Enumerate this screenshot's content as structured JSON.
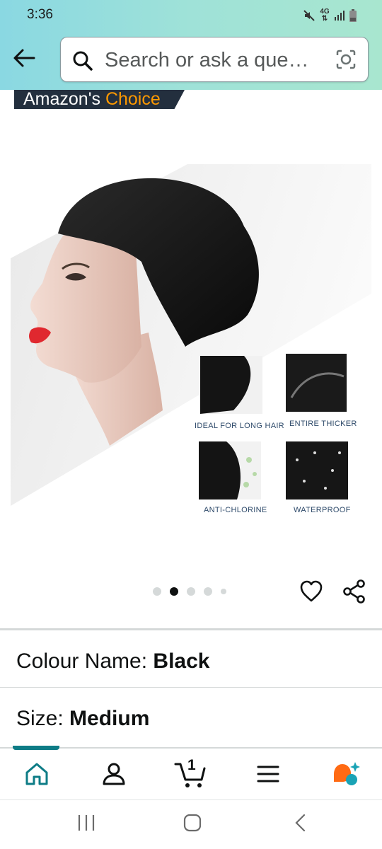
{
  "status_bar": {
    "time": "3:36",
    "network": "4G",
    "icons": [
      "mute-icon",
      "network-4g-icon",
      "signal-icon",
      "battery-icon"
    ]
  },
  "search": {
    "placeholder": "Search or ask a que…",
    "icons": [
      "back-arrow-icon",
      "search-icon",
      "camera-scan-icon"
    ]
  },
  "badge": {
    "prefix": "Amazon's",
    "highlight": "Choice"
  },
  "product_image": {
    "features": [
      {
        "caption": "IDEAL FOR LONG HAIR"
      },
      {
        "caption": "ENTIRE THICKER"
      },
      {
        "caption": "ANTI-CHLORINE"
      },
      {
        "caption": "WATERPROOF"
      }
    ]
  },
  "carousel": {
    "total_dots": 5,
    "active_index": 1
  },
  "actions": [
    "heart-icon",
    "share-icon"
  ],
  "variations": {
    "colour_label": "Colour Name: ",
    "colour_value": "Black",
    "size_label": "Size: ",
    "size_value": "Medium"
  },
  "bottom_nav": {
    "items": [
      "home-icon",
      "account-icon",
      "cart-icon",
      "menu-icon",
      "rufus-assistant-icon"
    ],
    "cart_count": "1",
    "active": "home",
    "colors": {
      "accent": "#0e7c86",
      "assistant_orange": "#ff6a13",
      "assistant_teal": "#1aa3b5"
    }
  },
  "system_nav": [
    "recent-apps-icon",
    "home-button-icon",
    "back-button-icon"
  ]
}
